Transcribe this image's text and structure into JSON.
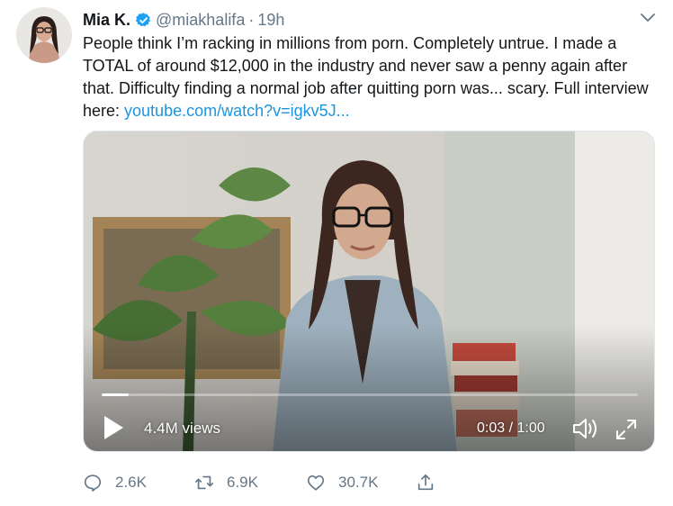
{
  "tweet": {
    "display_name": "Mia K.",
    "handle": "@miakhalifa",
    "separator": "·",
    "time": "19h",
    "text": "People think I’m racking in millions from porn. Completely untrue. I made a TOTAL of around $12,000 in the industry and never saw a penny again after that. Difficulty finding a normal job after quitting porn was... scary. Full interview here: ",
    "link_text": "youtube.com/watch?v=igkv5J..."
  },
  "video": {
    "views": "4.4M views",
    "time_readout": "0:03 / 1:00",
    "progress": 0.05
  },
  "actions": {
    "replies": "2.6K",
    "retweets": "6.9K",
    "likes": "30.7K"
  },
  "colors": {
    "link": "#1b95e0",
    "verified": "#1da1f2",
    "muted": "#657786"
  },
  "icons": [
    "verified-badge-icon",
    "chevron-down-icon",
    "play-icon",
    "volume-icon",
    "expand-icon",
    "reply-icon",
    "retweet-icon",
    "like-icon",
    "share-icon"
  ]
}
